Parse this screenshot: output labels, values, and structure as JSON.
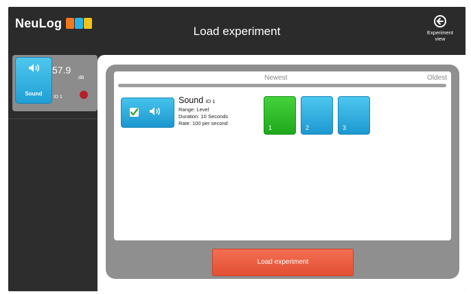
{
  "app": {
    "logo_text": "NeuLog",
    "title": "Load experiment"
  },
  "header": {
    "experiment_view_label": "Experiment view"
  },
  "sensor": {
    "name": "Sound",
    "value": "57.9",
    "unit": "dB",
    "id_label": "ID 1"
  },
  "experiment": {
    "sensor_name": "Sound",
    "sensor_id": "ID 1",
    "range": "Range: Level",
    "duration": "Duration: 10 Seconds",
    "rate": "Rate: 100 per second"
  },
  "history": {
    "newest_label": "Newest",
    "oldest_label": "Oldest"
  },
  "runs": [
    {
      "label": "1",
      "selected": true
    },
    {
      "label": "2",
      "selected": false
    },
    {
      "label": "3",
      "selected": false
    }
  ],
  "actions": {
    "load_label": "Load experiment"
  },
  "colors": {
    "sensor_blue": "#1f9fd4",
    "selected_green": "#2fbc27",
    "load_orange": "#e95a3d",
    "led_red": "#b3202a"
  }
}
